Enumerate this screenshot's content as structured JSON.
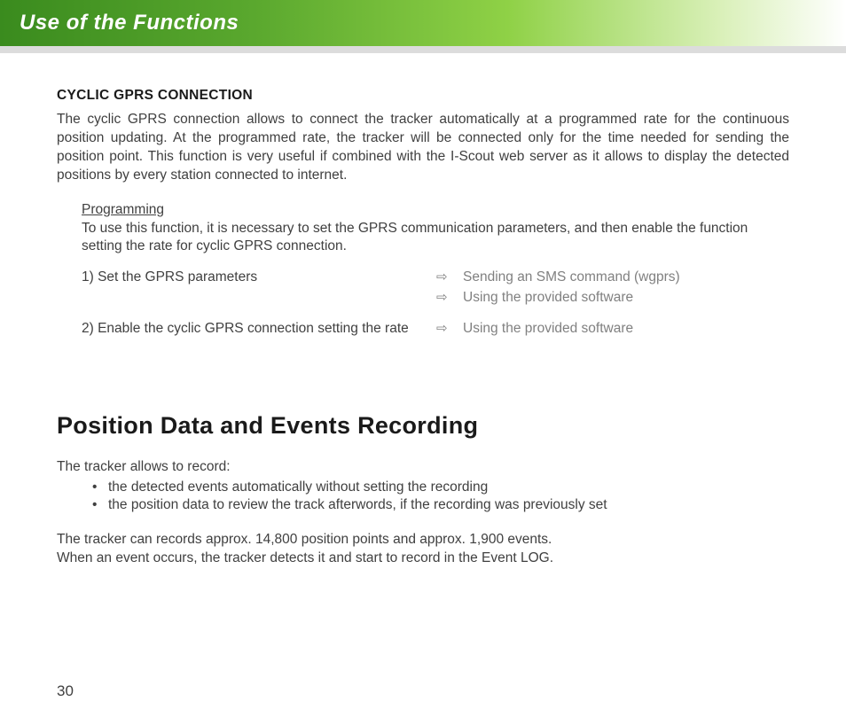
{
  "header": {
    "title": "Use of the Functions"
  },
  "section1": {
    "heading": "CYCLIC GPRS CONNECTION",
    "intro": "The cyclic GPRS connection allows to connect the tracker automatically at a programmed rate for the continuous position updating. At the programmed rate, the tracker will be connected only for the time needed for sending the position point. This function is very useful if combined with the I-Scout web server as it allows to display the detected positions by every station connected to internet.",
    "programming_label": "Programming",
    "programming_text": "To use this function, it is necessary to set the GPRS communication parameters, and then enable the function setting the rate for cyclic GPRS connection.",
    "step1_label": "1) Set the GPRS parameters",
    "step1_opt1": "Sending an SMS command (wgprs)",
    "step1_opt2": "Using the provided software",
    "step2_label": "2) Enable the cyclic GPRS connection setting the rate",
    "step2_opt1": "Using the provided software",
    "arrow": "⇨"
  },
  "section2": {
    "title": "Position Data and Events Recording",
    "intro": "The tracker allows to record:",
    "bullet1": "the detected events automatically without setting the recording",
    "bullet2": "the position data to review the track afterwords, if the recording was previously set",
    "para1": "The tracker can records approx. 14,800 position points and approx. 1,900 events.",
    "para2": "When an event occurs, the tracker detects it and start to record in the Event LOG.",
    "bullet_char": "•"
  },
  "page_number": "30"
}
